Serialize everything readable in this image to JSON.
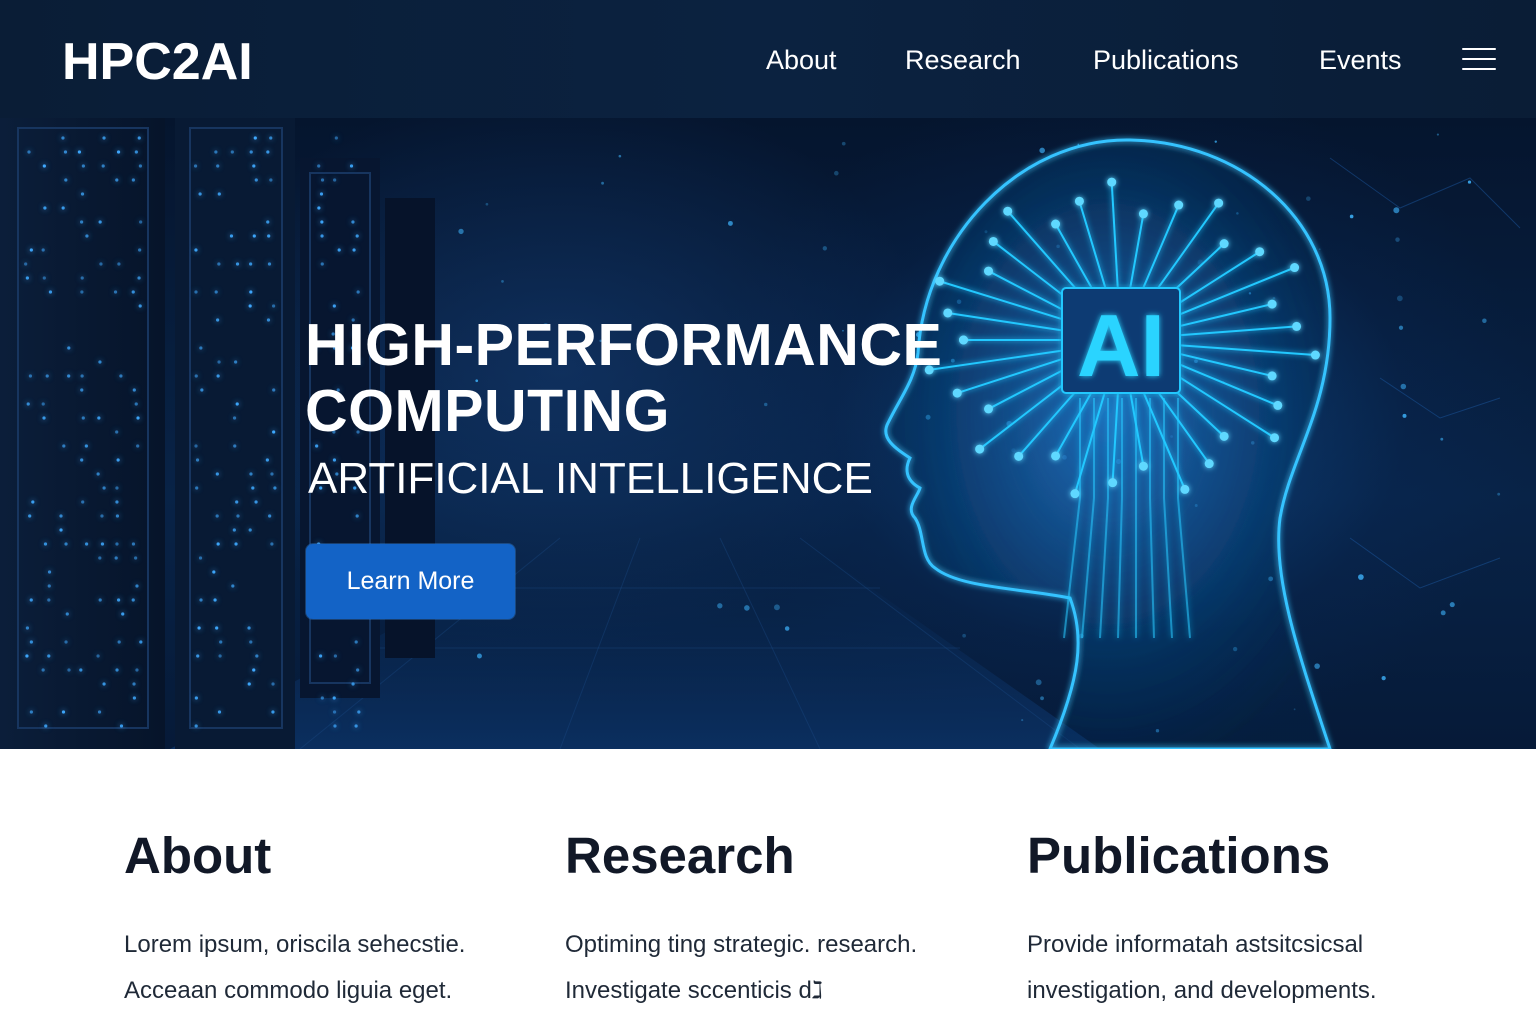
{
  "header": {
    "logo": "HPC2AI",
    "nav": [
      "About",
      "Research",
      "Publications",
      "Events"
    ],
    "menu_icon": "hamburger-menu-icon"
  },
  "hero": {
    "title_lines": [
      "HIGH-PERFORMANCE",
      "COMPUTING"
    ],
    "subtitle": "ARTIFICIAL INTELLIGENCE",
    "cta_label": "Learn More",
    "chip_label": "AI",
    "colors": {
      "accent": "#1363c6",
      "glow": "#22c8ff",
      "background": "#061a38"
    }
  },
  "sections": [
    {
      "heading": "About",
      "lines": [
        "Lorem ipsum, oriscila sehecstie.",
        "Acceaan commodo liguia eget."
      ]
    },
    {
      "heading": "Research",
      "lines": [
        "Optiming ting strategic. research.",
        "Investigate sccenticis  dℷ"
      ]
    },
    {
      "heading": "Publications",
      "lines": [
        "Provide informatah astsitcsicsal",
        "investigation, and developments."
      ]
    }
  ]
}
